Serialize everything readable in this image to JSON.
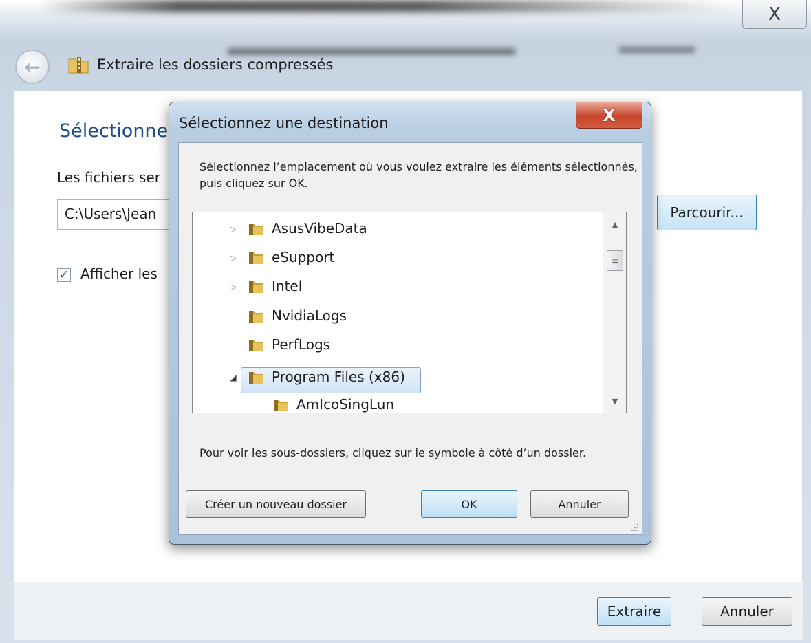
{
  "wizard": {
    "close_glyph": "X",
    "back_glyph": "←",
    "title": "Extraire les dossiers compressés",
    "heading": "Sélectionne",
    "files_label": "Les fichiers ser",
    "path_value": "C:\\Users\\Jean",
    "browse_label": "Parcourir...",
    "checkbox_glyph": "✓",
    "checkbox_checked": true,
    "checkbox_label": "Afficher les",
    "extract_label": "Extraire",
    "cancel_label": "Annuler"
  },
  "dialog": {
    "title": "Sélectionnez une destination",
    "close_glyph": "X",
    "instructions": "Sélectionnez l’emplacement où vous voulez extraire les éléments sélectionnés, puis cliquez sur OK.",
    "tree": [
      {
        "label": "AsusVibeData",
        "expandable": true,
        "expanded": false,
        "selected": false
      },
      {
        "label": "eSupport",
        "expandable": true,
        "expanded": false,
        "selected": false
      },
      {
        "label": "Intel",
        "expandable": true,
        "expanded": false,
        "selected": false
      },
      {
        "label": "NvidiaLogs",
        "expandable": false,
        "expanded": false,
        "selected": false
      },
      {
        "label": "PerfLogs",
        "expandable": false,
        "expanded": false,
        "selected": false
      },
      {
        "label": "Program Files (x86)",
        "expandable": true,
        "expanded": true,
        "selected": true
      },
      {
        "label": "AmIcoSingLun",
        "expandable": false,
        "expanded": false,
        "selected": false
      }
    ],
    "expander_collapsed": "▷",
    "expander_expanded": "◢",
    "scroll_up": "▲",
    "scroll_down": "▼",
    "scroll_thumb": "≡",
    "hint": "Pour voir les sous-dossiers, cliquez sur le symbole à côté d’un dossier.",
    "new_folder_label": "Créer un nouveau dossier",
    "ok_label": "OK",
    "cancel_label": "Annuler",
    "folder_color": "#e8c25a",
    "selection_color": "#d2e4f8"
  }
}
